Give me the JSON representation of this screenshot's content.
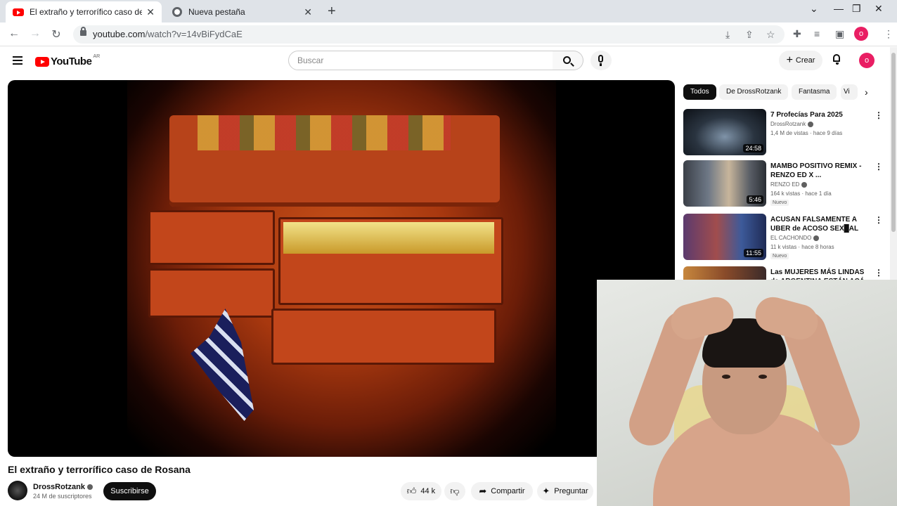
{
  "browser": {
    "tabs": [
      {
        "title": "El extraño y terrorífico caso de Ro",
        "active": true,
        "icon": "youtube-icon"
      },
      {
        "title": "Nueva pestaña",
        "active": false,
        "icon": "chrome-icon"
      }
    ],
    "url_host": "youtube.com",
    "url_path": "/watch?v=14vBiFydCaE",
    "profile_initial": "o"
  },
  "youtube": {
    "country_code": "AR",
    "search_placeholder": "Buscar",
    "create_label": "Crear",
    "avatar_initial": "o"
  },
  "video": {
    "title": "El extraño y terrorífico caso de Rosana",
    "channel": "DrossRotzank",
    "subscribers": "24 M de suscriptores",
    "subscribe_label": "Suscribirse",
    "likes": "44 k",
    "share_label": "Compartir",
    "ask_label": "Preguntar"
  },
  "chips": [
    "Todos",
    "De DrossRotzank",
    "Fantasma",
    "Vi"
  ],
  "recommendations": [
    {
      "title": "7 Profecías Para 2025",
      "channel": "DrossRotzank",
      "meta": "1,4 M de vistas · hace 9 días",
      "duration": "24:58",
      "new": ""
    },
    {
      "title": "MAMBO POSITIVO REMIX - RENZO ED X ...",
      "channel": "RENZO ED",
      "meta": "164 k vistas · hace 1 día",
      "duration": "5:46",
      "new": "Nuevo"
    },
    {
      "title": "ACUSAN FALSAMENTE A UBER de ACOSO SEX█AL y...",
      "channel": "EL CACHONDO",
      "meta": "11 k vistas · hace 8 horas",
      "duration": "11:55",
      "new": "Nuevo"
    },
    {
      "title": "Las MUJERES MÁS LINDAS de ARGENTINA ESTÁN ACÁ",
      "channel": "",
      "meta": "",
      "duration": "",
      "new": ""
    }
  ],
  "colors": {
    "accent": "#ff0000",
    "avatar": "#e91e63"
  }
}
